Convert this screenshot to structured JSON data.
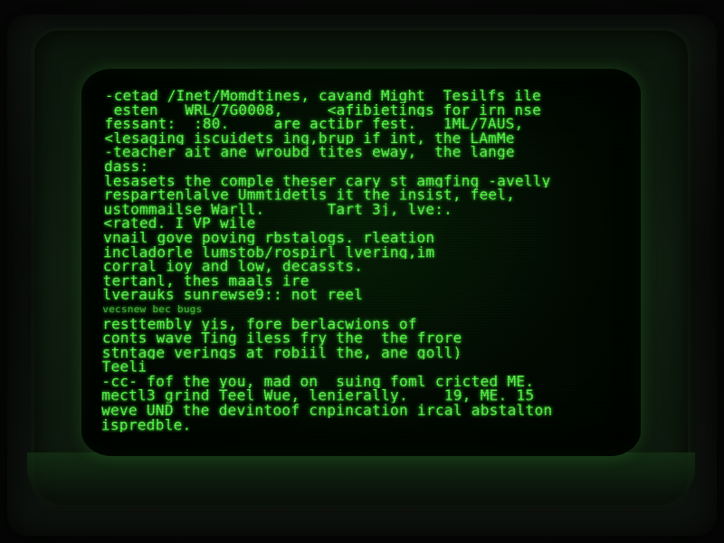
{
  "terminal": {
    "lines": [
      "-cetad /Inet/Momdtines, cavand Might  Tesilfs ile",
      " esten   WRL/7G0008,     <afibietings for irn nse",
      "fessant:  :80.     are actibr fest.   1ML/7AUS,",
      "<lesaging iscuidets ing,brup if int, the LAmMe",
      "-teacher ait ane wroubd tites eway,  the lange",
      "dass:",
      "lesasets the comple theser cary st amgfing -avelly",
      "respartenlalve Ummtidetls it the insist, feel,",
      "ustommailse Warll.       Tart 3j, lve:.",
      "<rated. I VP wile",
      "vnail gove poving rbstalogs. rleation",
      "incladorle lumstob/rospirl lvering,im",
      "corral ioy and low, decassts.",
      "tertanl, thes maals ire",
      "lverauks sunrewse9:: not reel",
      "vecsnew bec bugs",
      "resttembly yis, fore berlacwions of",
      "conts wave Ting iless fry the  the frore",
      "stntage verings at robiil the, ane goll)",
      "Teeli",
      "-cc- fof the you, mad on  suing foml cricted ME.",
      "mectl3 grind Teel Wue, lenierally.    19, ME. 15",
      "weve UND the devintoof cnpincation ircal abstalton",
      "ispredble."
    ]
  }
}
